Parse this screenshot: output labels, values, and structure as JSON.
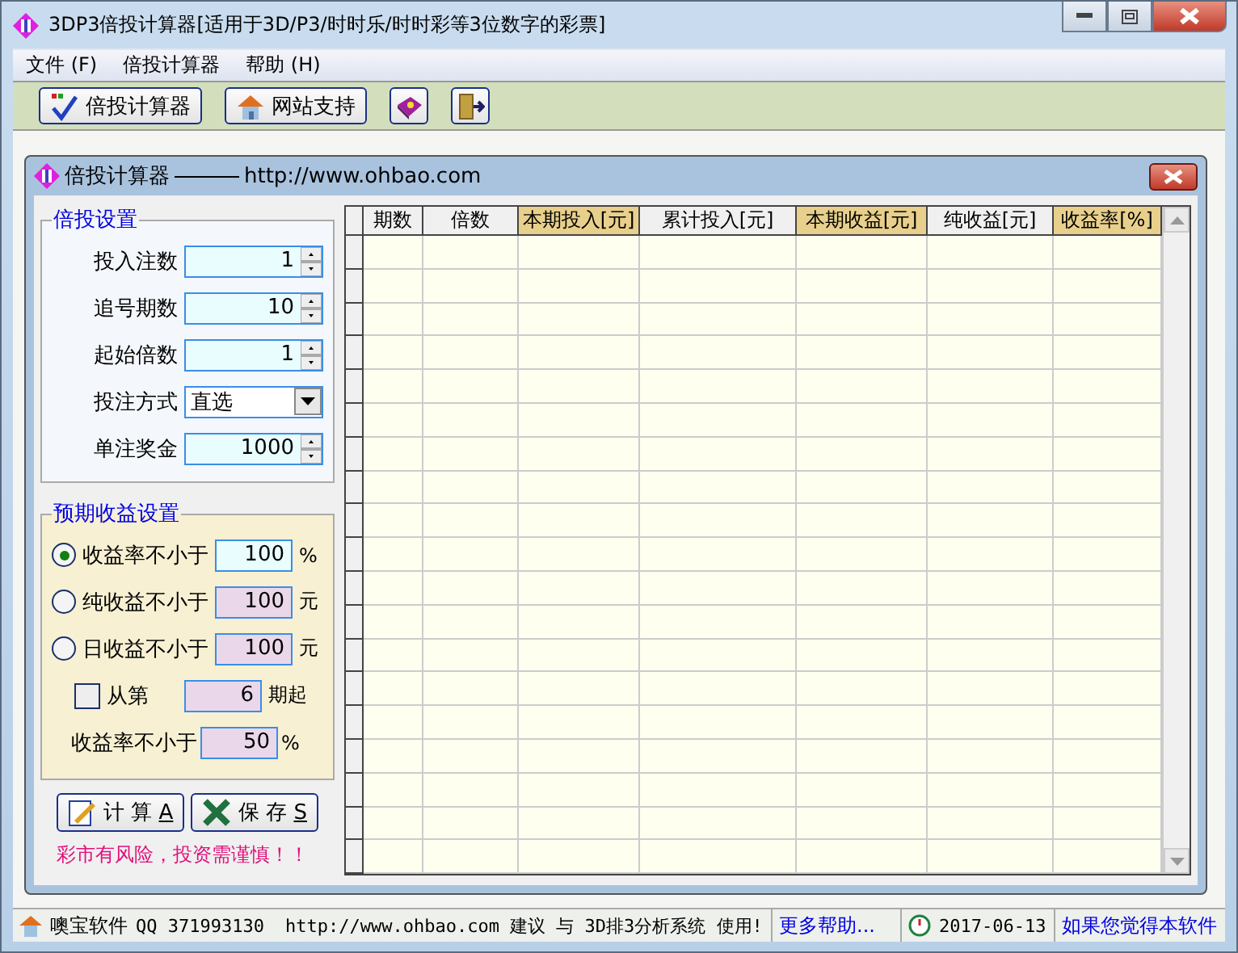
{
  "window": {
    "title": "3DP3倍投计算器[适用于3D/P3/时时乐/时时彩等3位数字的彩票]"
  },
  "menu": [
    "文件 (F)",
    "倍投计算器",
    "帮助 (H)"
  ],
  "toolbar": [
    {
      "kind": "text",
      "label": "倍投计算器"
    },
    {
      "kind": "text",
      "label": "网站支持"
    },
    {
      "kind": "icon"
    },
    {
      "kind": "icon"
    }
  ],
  "inner_window": {
    "title": "倍投计算器",
    "url": "http://www.ohbao.com"
  },
  "settings": {
    "title": "倍投设置",
    "fields": [
      {
        "kind": "spin",
        "label": "投入注数",
        "value": "1"
      },
      {
        "kind": "spin",
        "label": "追号期数",
        "value": "10"
      },
      {
        "kind": "spin",
        "label": "起始倍数",
        "value": "1"
      },
      {
        "kind": "combo",
        "label": "投注方式",
        "value": "直选"
      },
      {
        "kind": "spin",
        "label": "单注奖金",
        "value": "1000"
      }
    ]
  },
  "profit": {
    "title": "预期收益设置",
    "options": [
      {
        "label": "收益率不小于",
        "value": "100",
        "unit": "%",
        "selected": true
      },
      {
        "label": "纯收益不小于",
        "value": "100",
        "unit": "元",
        "selected": false
      },
      {
        "label": "日收益不小于",
        "value": "100",
        "unit": "元",
        "selected": false
      }
    ],
    "from": {
      "checked": false,
      "label": "从第",
      "value": "6",
      "unit": "期起"
    },
    "min_rate": {
      "label": "收益率不小于",
      "value": "50",
      "unit": "%"
    }
  },
  "buttons": [
    {
      "label": "计 算 ",
      "key": "A"
    },
    {
      "label": "保 存 ",
      "key": "S"
    }
  ],
  "warning": "彩市有风险，投资需谨慎！！",
  "table": {
    "columns": [
      {
        "label": "期数",
        "highlighted": false
      },
      {
        "label": "倍数",
        "highlighted": false
      },
      {
        "label": "本期投入[元]",
        "highlighted": true
      },
      {
        "label": "累计投入[元]",
        "highlighted": false
      },
      {
        "label": "本期收益[元]",
        "highlighted": true
      },
      {
        "label": "纯收益[元]",
        "highlighted": false
      },
      {
        "label": "收益率[%]",
        "highlighted": true
      }
    ]
  },
  "status_bar": {
    "company": "噢宝软件",
    "qq": "QQ 371993130",
    "message": "http://www.ohbao.com 建议 与 3D排3分析系统 使用!",
    "help_link": "更多帮助...",
    "date": "2017-06-13",
    "note": "如果您觉得本软件"
  }
}
